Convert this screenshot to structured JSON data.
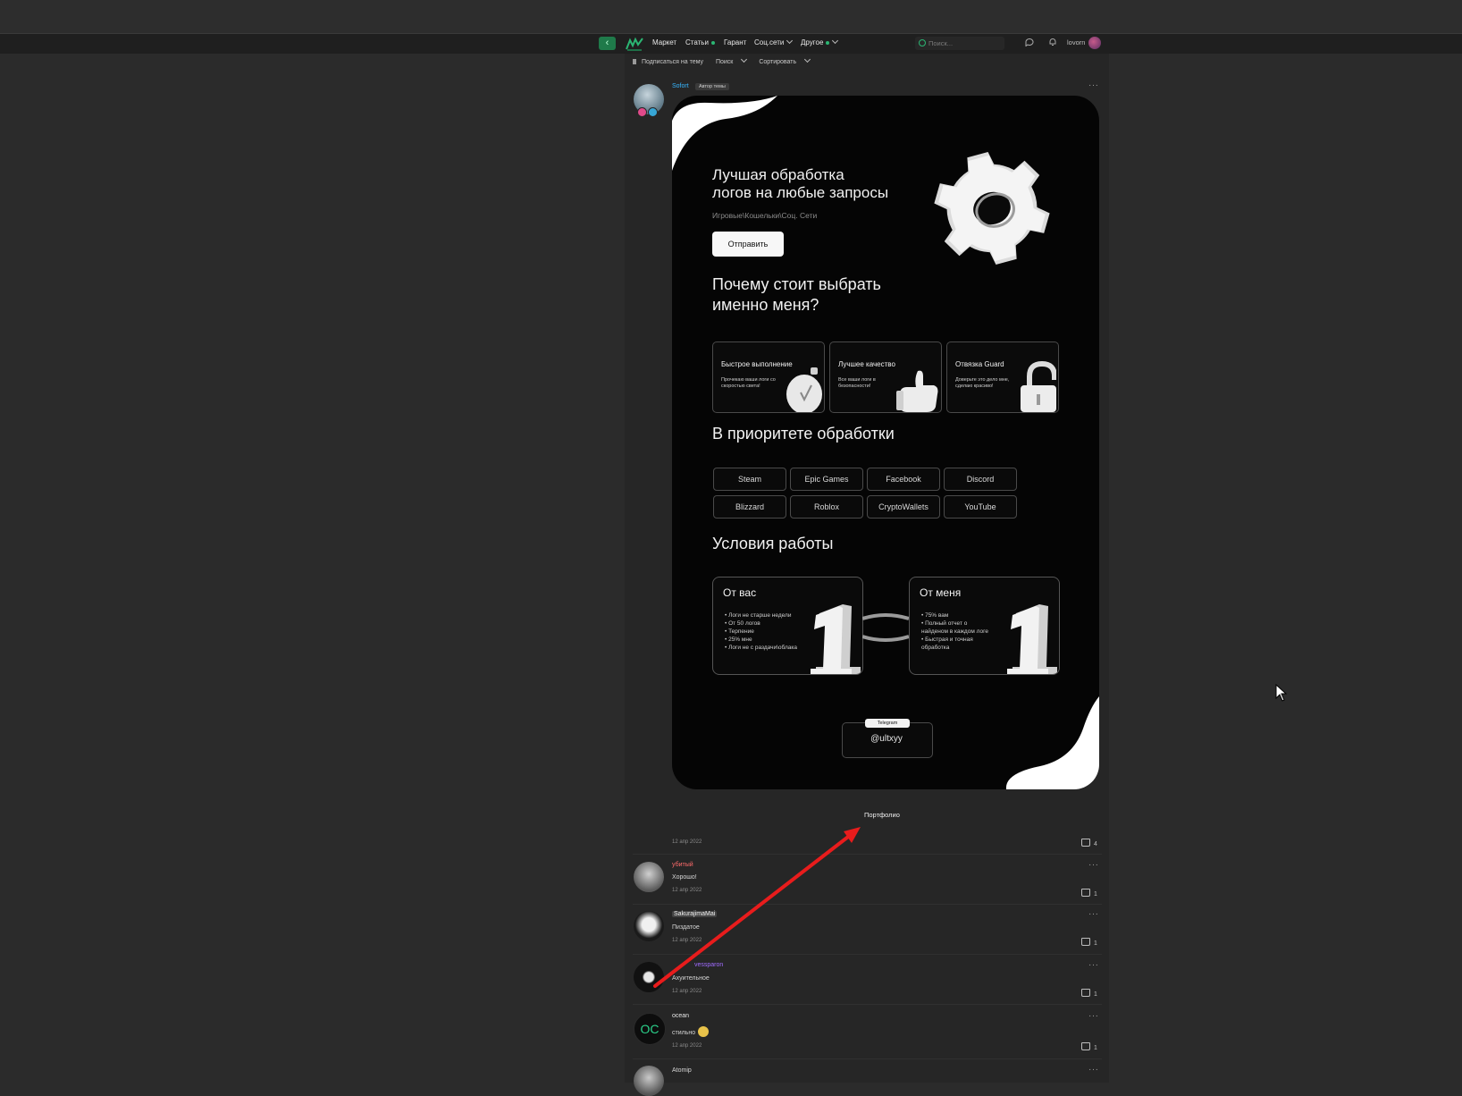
{
  "nav": {
    "back_icon": "‹",
    "items": [
      "Маркет",
      "Статьи",
      "Гарант",
      "Соц.сети",
      "Другое"
    ],
    "search_placeholder": "Поиск...",
    "username": "lovorn"
  },
  "thread_toolbar": {
    "subscribe": "Подписаться на тему",
    "search": "Поиск",
    "sort": "Сортировать"
  },
  "op": {
    "name": "Sofort",
    "tag": "Автор темы",
    "date": "12 апр 2022",
    "likes": "4"
  },
  "banner": {
    "title_line1": "Лучшая обработка",
    "title_line2": "логов на любые запросы",
    "subtitle": "Игровые\\Кошельки\\Соц. Сети",
    "send_button": "Отправить",
    "why_line1": "Почему стоит выбрать",
    "why_line2": "именно меня?",
    "features": [
      {
        "title": "Быстрое выполнение",
        "desc": "Прочекаю ваши логи со скоростью света!"
      },
      {
        "title": "Лучшее качество",
        "desc": "Все ваши логи в безопасности!"
      },
      {
        "title": "Отвязка Guard",
        "desc": "Доверьте это дело мне, сделаю красиво!"
      }
    ],
    "priority_title": "В приоритете обработки",
    "tags": [
      "Steam",
      "Epic Games",
      "Facebook",
      "Discord",
      "Blizzard",
      "Roblox",
      "CryptoWallets",
      "YouTube"
    ],
    "conditions_title": "Условия работы",
    "from_you_title": "От вас",
    "from_you": [
      "• Логи не старше недели",
      "• От 50 логов",
      "• Терпение",
      "• 25% мне",
      "• Логи не с раздачи\\облака"
    ],
    "from_me_title": "От меня",
    "from_me": [
      "• 75% вам",
      "• Полный отчет о",
      "  найденом в каждом логе",
      "• Быстрая и точная",
      "  обработка"
    ],
    "telegram_label": "Telegram",
    "telegram_handle": "@ultxyy"
  },
  "portfolio": "Портфолио",
  "comments": [
    {
      "name": "убитый",
      "name_color": "#ff6b6b",
      "text": "Хорошо!",
      "date": "12 апр 2022",
      "likes": "1"
    },
    {
      "name": "SakurajimaMai",
      "name_color": "#e6e6e6",
      "text": "Пиздатое",
      "date": "12 апр 2022",
      "likes": "1"
    },
    {
      "name": "vessparon",
      "name_color": "#a06bff",
      "text": "Ахуительное",
      "date": "12 апр 2022",
      "likes": "1"
    },
    {
      "name": "ocean",
      "name_color": "#e6e6e6",
      "text": "стильно",
      "date": "12 апр 2022",
      "likes": "1",
      "avatar_text": "OC"
    },
    {
      "name": "Atomip",
      "name_color": "#bdbdbd",
      "text": "",
      "date": "",
      "likes": ""
    }
  ],
  "colors": {
    "accent_green": "#2bb673",
    "arrow_red": "#e81c1c",
    "link_blue": "#37b6ff"
  }
}
